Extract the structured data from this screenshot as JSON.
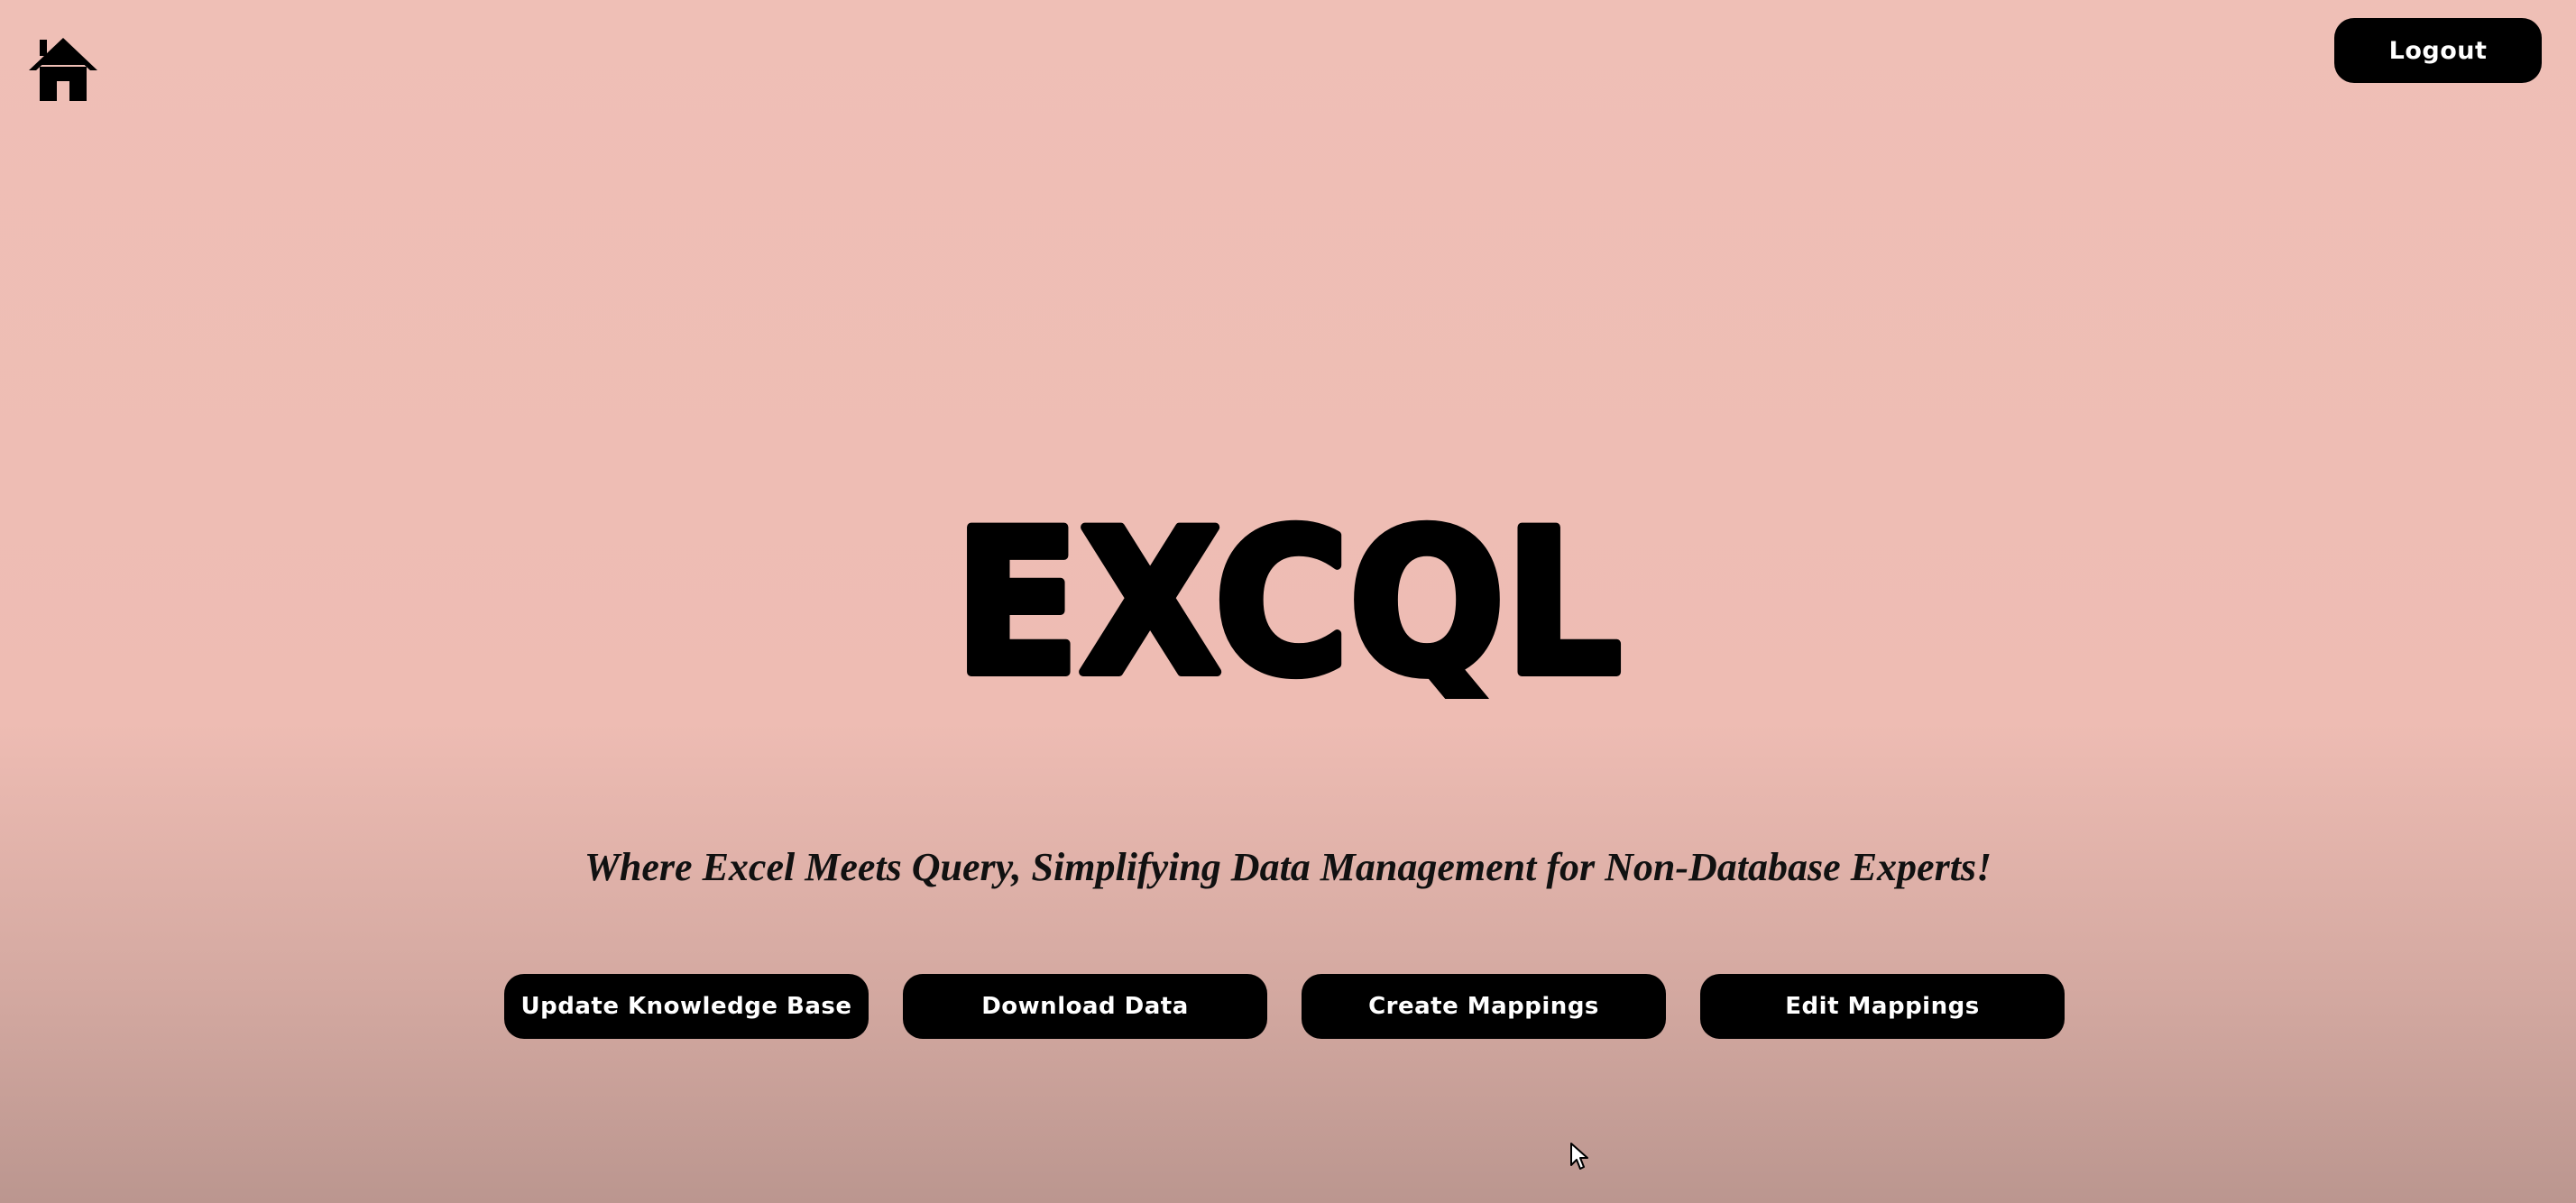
{
  "app": {
    "logo_text": "EXCQL",
    "tagline": "Where Excel Meets Query, Simplifying Data Management for Non-Database Experts!"
  },
  "header": {
    "home_icon": "home-icon",
    "logout_label": "Logout"
  },
  "actions": [
    {
      "label": "Update Knowledge Base"
    },
    {
      "label": "Download Data"
    },
    {
      "label": "Create Mappings"
    },
    {
      "label": "Edit Mappings"
    }
  ],
  "colors": {
    "background_top": "#efbfb6",
    "background_bottom": "#bb968f",
    "button_bg": "#000000",
    "button_text": "#ffffff"
  }
}
